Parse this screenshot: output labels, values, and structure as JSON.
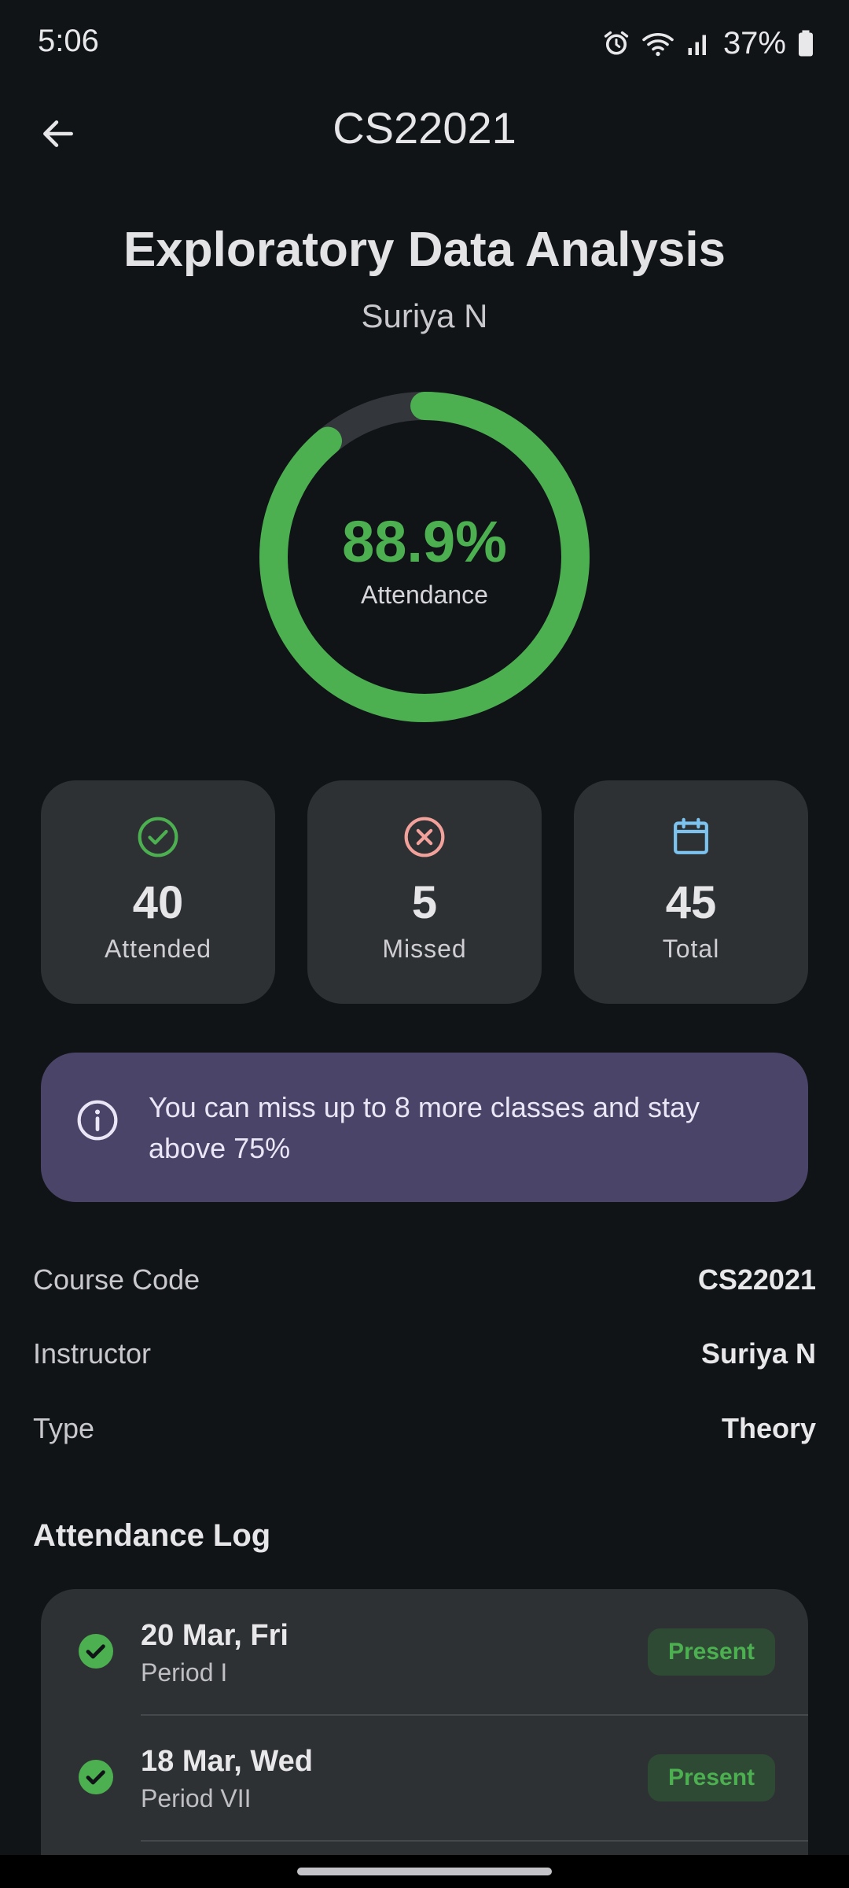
{
  "status_bar": {
    "time": "5:06",
    "battery": "37%",
    "icons": [
      "alarm-icon",
      "wifi-icon",
      "signal-icon",
      "battery-icon"
    ]
  },
  "app_bar": {
    "title": "CS22021",
    "back_icon": "arrow-back-icon"
  },
  "course": {
    "name": "Exploratory Data Analysis",
    "instructor": "Suriya N"
  },
  "attendance": {
    "percent_text": "88.9%",
    "percent_value": 88.9,
    "label": "Attendance"
  },
  "stats": [
    {
      "icon": "check-circle-icon",
      "value": "40",
      "label": "Attended",
      "color": "#4caf50"
    },
    {
      "icon": "cancel-circle-icon",
      "value": "5",
      "label": "Missed",
      "color": "#f2a19b"
    },
    {
      "icon": "calendar-icon",
      "value": "45",
      "label": "Total",
      "color": "#7cc3f0"
    }
  ],
  "info_banner": {
    "icon": "info-icon",
    "text": "You can miss up to 8 more classes and stay above 75%"
  },
  "details": [
    {
      "label": "Course Code",
      "value": "CS22021"
    },
    {
      "label": "Instructor",
      "value": "Suriya N"
    },
    {
      "label": "Type",
      "value": "Theory"
    }
  ],
  "log": {
    "heading": "Attendance Log",
    "entries": [
      {
        "date": "20 Mar, Fri",
        "period": "Period I",
        "status": "Present"
      },
      {
        "date": "18 Mar, Wed",
        "period": "Period VII",
        "status": "Present"
      }
    ]
  },
  "colors": {
    "background": "#101417",
    "card": "#2e3134",
    "accent_green": "#4caf50",
    "ring_track": "#33363a",
    "banner": "#4a4468"
  }
}
